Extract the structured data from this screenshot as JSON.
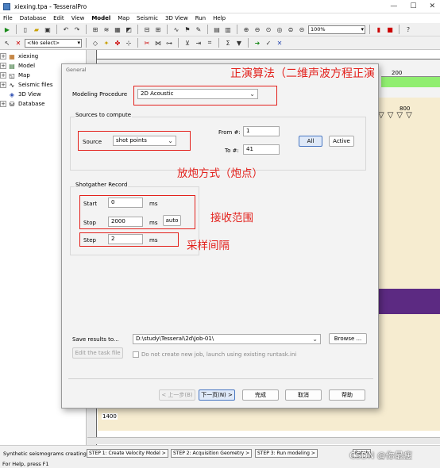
{
  "window": {
    "title": "xiexing.tpa - TesseralPro",
    "minimize": "—",
    "maximize": "☐",
    "close": "✕"
  },
  "menu": [
    "File",
    "Database",
    "Edit",
    "View",
    "Model",
    "Map",
    "Seismic",
    "3D View",
    "Run",
    "Help"
  ],
  "menu_active": "Model",
  "toolbar": {
    "zoom_value": "100%",
    "select_value": "<No select>"
  },
  "tree": {
    "items": [
      {
        "label": "xiexing",
        "icon": "grid-icon",
        "expand": "+"
      },
      {
        "label": "Model",
        "icon": "model-icon",
        "expand": "+"
      },
      {
        "label": "Map",
        "icon": "map-icon",
        "expand": "+"
      },
      {
        "label": "Seismic files",
        "icon": "seismic-icon",
        "expand": "+"
      },
      {
        "label": "3D View",
        "icon": "cube-icon",
        "expand": ""
      },
      {
        "label": "Database",
        "icon": "database-icon",
        "expand": "+"
      }
    ]
  },
  "canvas": {
    "label_200": "200",
    "label_800": "800",
    "label_1400": "1400"
  },
  "dialog": {
    "title": "General",
    "modeling_procedure_label": "Modeling Procedure",
    "modeling_procedure_value": "2D Acoustic",
    "sources_group_title": "Sources to compute",
    "source_label": "Source",
    "source_value": "shot points",
    "from_label": "From #:",
    "from_value": "1",
    "to_label": "To #:",
    "to_value": "41",
    "all_button": "All",
    "active_button": "Active",
    "shotgather_group_title": "Shotgather Record",
    "start_label": "Start",
    "start_value": "0",
    "start_unit": "ms",
    "stop_label": "Stop",
    "stop_value": "2000",
    "stop_unit": "ms",
    "auto_button": "auto",
    "step_label": "Step",
    "step_value": "2",
    "step_unit": "ms",
    "save_label": "Save results to...",
    "save_path": "D:\\study\\Tesseral\\2d\\Job-01\\",
    "browse_button": "Browse ...",
    "edit_task_button": "Edit the task file",
    "no_new_job_label": "Do not create new job, launch using existing runtask.ini",
    "prev_button": "< 上一步(B)",
    "next_button": "下一页(N) >",
    "finish_button": "完成",
    "cancel_button": "取消",
    "help_button": "帮助"
  },
  "annotations": {
    "procedure": "正演算法（二维声波方程正演",
    "source": "放炮方式（炮点）",
    "record": "接收范围",
    "step": "采样间隔"
  },
  "steps": {
    "caption": "Synthetic seismograms creating:",
    "step1": "STEP 1: Create Velocity Model >",
    "step2": "STEP 2: Acquisition Geometry >",
    "step3": "STEP 3: Run modeling >",
    "step4": "Batch"
  },
  "status": "For Help, press F1",
  "watermark": "CSDN @你最瘦",
  "colors": {
    "annotation_red": "#e3211c",
    "accent_blue": "#4a78c2",
    "green_band": "#90ee70",
    "purple_band": "#5c2a82"
  }
}
